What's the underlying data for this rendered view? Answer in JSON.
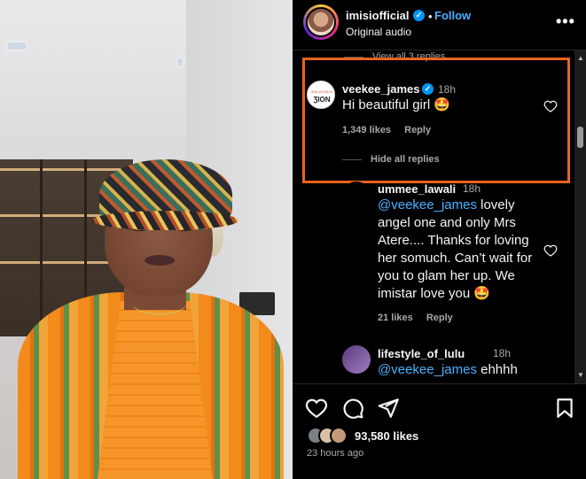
{
  "header": {
    "username": "imisiofficial",
    "verified_icon": "check-icon",
    "separator": "•",
    "follow_label": "Follow",
    "audio_label": "Original audio",
    "more_label": "•••"
  },
  "comments": {
    "view_all_label": "View all 3 replies",
    "highlight_color": "#e8641e",
    "items": [
      {
        "username": "veekee_james",
        "avatar_label": "ƷION",
        "avatar_sublabel": "ISALASHEYA",
        "verified": true,
        "time": "18h",
        "text": "Hi beautiful girl",
        "emoji": "🤩",
        "likes": "1,349 likes",
        "reply_label": "Reply",
        "hide_replies_label": "Hide all replies"
      },
      {
        "username": "ummee_lawali",
        "time": "18h",
        "mention": "@veekee_james",
        "text": " lovely angel one and only Mrs Atere.... Thanks for loving her somuch. Can’t wait for you to glam her up. We imistar love you ",
        "emoji": "🤩",
        "likes": "21 likes",
        "reply_label": "Reply"
      },
      {
        "username": "lifestyle_of_lulu",
        "time": "18h",
        "mention": "@veekee_james",
        "text": " ehhhh"
      }
    ]
  },
  "footer": {
    "likes": "93,580 likes",
    "time_ago": "23 hours ago"
  },
  "scrollbar": {
    "up_icon": "▲",
    "down_icon": "▼"
  }
}
